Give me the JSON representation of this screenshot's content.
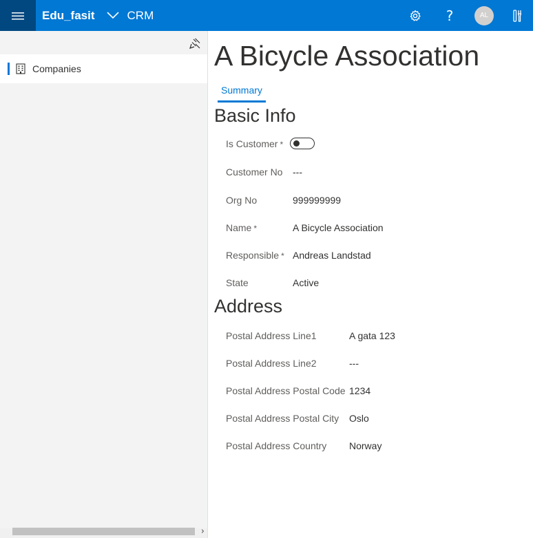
{
  "header": {
    "app_name": "Edu_fasit",
    "module": "CRM",
    "avatar_initials": "AL",
    "help_glyph": "?"
  },
  "sidebar": {
    "items": [
      {
        "label": "Companies",
        "icon": "building-icon",
        "active": true
      }
    ]
  },
  "record": {
    "title": "A Bicycle Association",
    "tabs": [
      {
        "label": "Summary",
        "active": true
      }
    ]
  },
  "basic_info": {
    "title": "Basic Info",
    "is_customer": {
      "label": "Is Customer",
      "required": "*",
      "value": false
    },
    "customer_no": {
      "label": "Customer No",
      "value": "---"
    },
    "org_no": {
      "label": "Org No",
      "value": "999999999"
    },
    "name": {
      "label": "Name",
      "required": "*",
      "value": "A Bicycle Association"
    },
    "responsible": {
      "label": "Responsible",
      "required": "*",
      "value": "Andreas Landstad"
    },
    "state": {
      "label": "State",
      "value": "Active"
    }
  },
  "address": {
    "title": "Address",
    "line1": {
      "label": "Postal Address Line1",
      "value": "A gata 123"
    },
    "line2": {
      "label": "Postal Address Line2",
      "value": "---"
    },
    "postal_code": {
      "label": "Postal Address Postal Code",
      "value": "1234"
    },
    "postal_city": {
      "label": "Postal Address Postal City",
      "value": "Oslo"
    },
    "country": {
      "label": "Postal Address Country",
      "value": "Norway"
    }
  },
  "scrollbar": {
    "arrow": "›"
  },
  "colors": {
    "accent": "#0078d4",
    "accent_dark": "#00487f",
    "sidebar_bg": "#f3f3f3"
  }
}
